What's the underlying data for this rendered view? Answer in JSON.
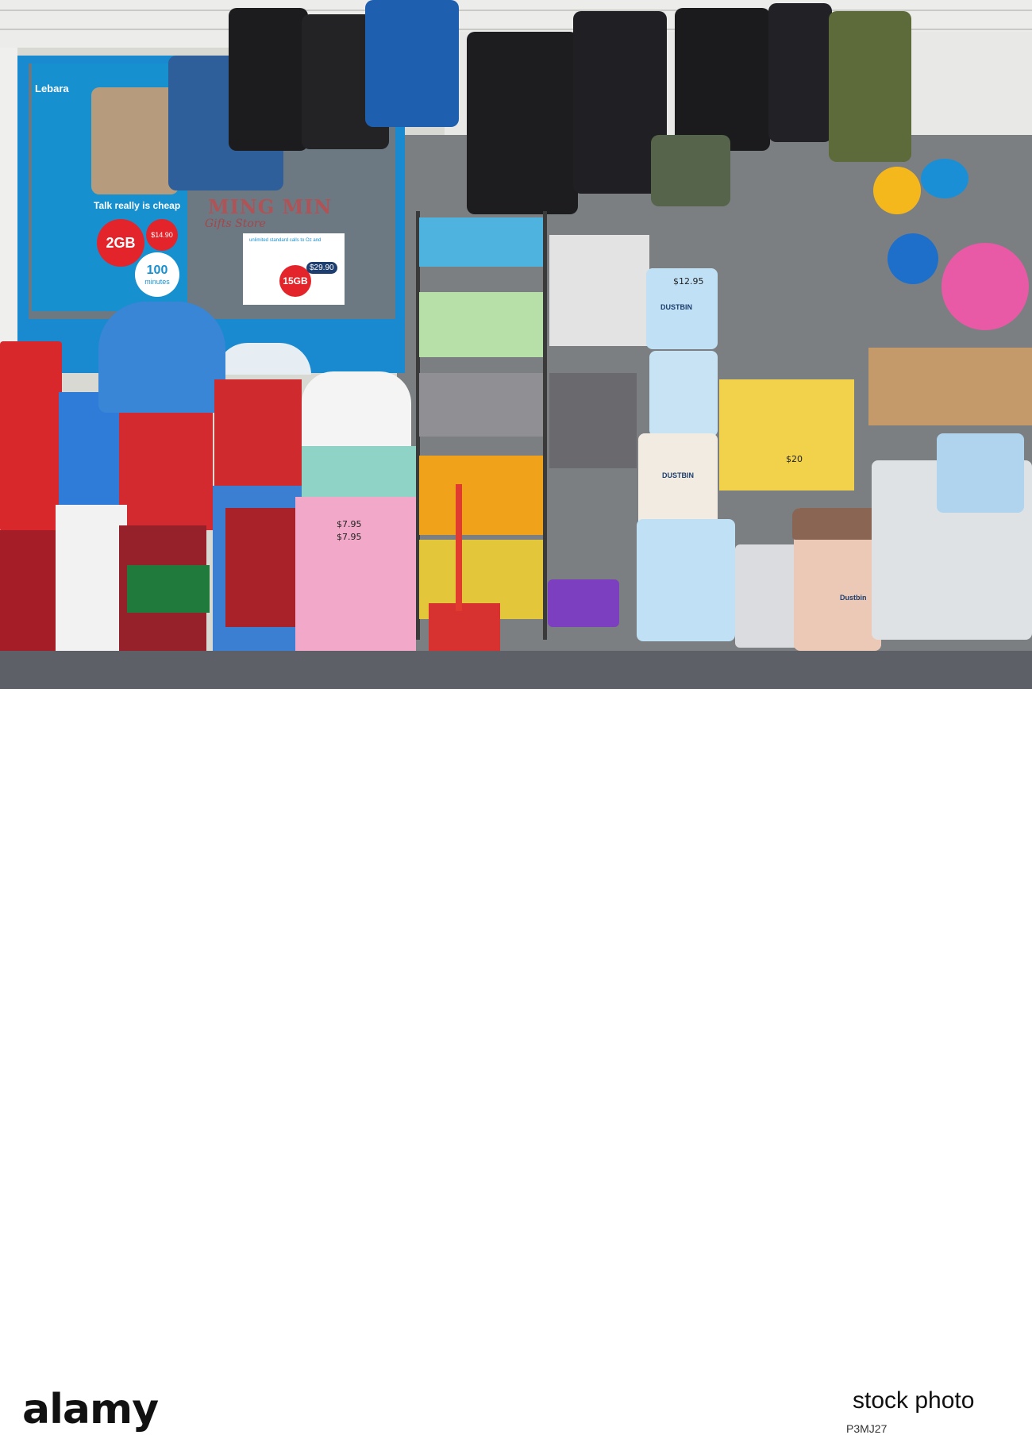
{
  "poster_lebara": {
    "brand": "Lebara",
    "headline": "Talk really is cheap",
    "data_amount": "2GB",
    "price": "$14.90",
    "minutes_value": "100",
    "minutes_unit": "minutes"
  },
  "poster_second": {
    "headline": "unlimited standard calls to Oz and",
    "data_amount": "15GB",
    "price": "$29.90"
  },
  "window_sign": {
    "title": "MING MIN",
    "subtitle": "Gifts Store"
  },
  "product_labels": {
    "dustbin_1": "DUSTBIN",
    "dustbin_2": "DUSTBIN",
    "dustbin_3": "Dustbin",
    "basket_price_1": "$7.95",
    "basket_price_2": "$7.95",
    "bin_price": "$12.95",
    "shelf_price": "$20"
  },
  "watermark": {
    "brand": "alamy",
    "stock_word": "stock photo",
    "image_id": "P3MJ27"
  },
  "colors": {
    "lebara_blue": "#1790d0",
    "window_frame": "#1a8ad0",
    "stool_red": "#d8282b",
    "stool_blue": "#2f7bd8",
    "basket_pink": "#f2a8c8",
    "bin_light_blue": "#bfe0f5"
  }
}
